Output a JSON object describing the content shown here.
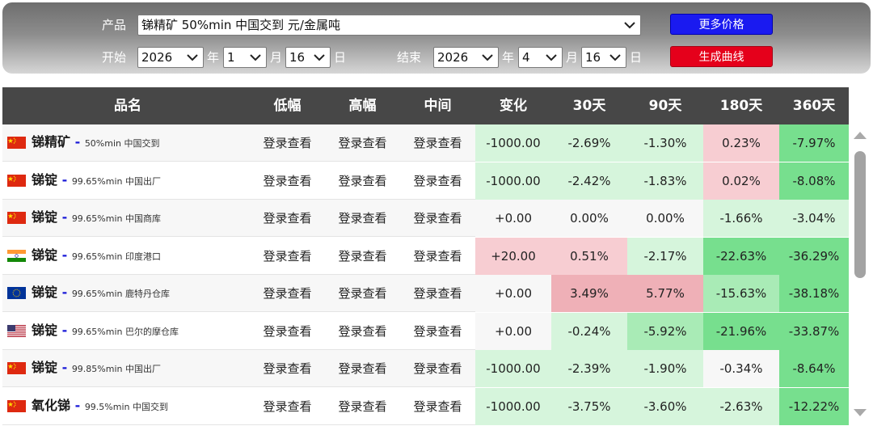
{
  "filters": {
    "product_label": "产品",
    "product_value": "锑精矿 50%min 中国交到 元/金属吨",
    "start_label": "开始",
    "end_label": "结束",
    "start": {
      "year": "2026",
      "year_unit": "年",
      "month": "1",
      "month_unit": "月",
      "day": "16",
      "day_unit": "日"
    },
    "end": {
      "year": "2026",
      "year_unit": "年",
      "month": "4",
      "month_unit": "月",
      "day": "16",
      "day_unit": "日"
    },
    "more_prices_button": "更多价格",
    "generate_curve_button": "生成曲线"
  },
  "colors": {
    "blue_button": "#1a1af0",
    "red_button": "#e5001b",
    "header_bg": "#474747",
    "neutral_cell": "#f7f7f7",
    "green_light": "#d6f5dc",
    "green_mid": "#a9ebb6",
    "green_strong": "#77df8e",
    "red_light": "#f7cdd2",
    "red_mid": "#efb0b7"
  },
  "table": {
    "headers": [
      "品名",
      "低幅",
      "高幅",
      "中间",
      "变化",
      "30天",
      "90天",
      "180天",
      "360天"
    ],
    "rows": [
      {
        "flag": "china-flag",
        "name": "锑精矿",
        "dash": "-",
        "spec": "50%min 中国交到",
        "low": "登录查看",
        "high": "登录查看",
        "mid": "登录查看",
        "change": "-1000.00",
        "d30": "-2.69%",
        "d90": "-1.30%",
        "d180": "0.23%",
        "d360": "-7.97%",
        "tones": [
          "green_light",
          "green_light",
          "green_light",
          "red_light",
          "green_strong"
        ]
      },
      {
        "flag": "china-flag",
        "name": "锑锭",
        "dash": "-",
        "spec": "99.65%min 中国出厂",
        "low": "登录查看",
        "high": "登录查看",
        "mid": "登录查看",
        "change": "-1000.00",
        "d30": "-2.42%",
        "d90": "-1.83%",
        "d180": "0.02%",
        "d360": "-8.08%",
        "tones": [
          "green_light",
          "green_light",
          "green_light",
          "red_light",
          "green_strong"
        ]
      },
      {
        "flag": "china-flag",
        "name": "锑锭",
        "dash": "-",
        "spec": "99.65%min 中国商库",
        "low": "登录查看",
        "high": "登录查看",
        "mid": "登录查看",
        "change": "+0.00",
        "d30": "0.00%",
        "d90": "0.00%",
        "d180": "-1.66%",
        "d360": "-3.04%",
        "tones": [
          "neutral_cell",
          "neutral_cell",
          "neutral_cell",
          "green_light",
          "green_light"
        ]
      },
      {
        "flag": "india-flag",
        "name": "锑锭",
        "dash": "-",
        "spec": "99.65%min 印度港口",
        "low": "登录查看",
        "high": "登录查看",
        "mid": "登录查看",
        "change": "+20.00",
        "d30": "0.51%",
        "d90": "-2.17%",
        "d180": "-22.63%",
        "d360": "-36.29%",
        "tones": [
          "red_light",
          "red_light",
          "green_light",
          "green_strong",
          "green_strong"
        ]
      },
      {
        "flag": "eu-flag",
        "name": "锑锭",
        "dash": "-",
        "spec": "99.65%min 鹿特丹仓库",
        "low": "登录查看",
        "high": "登录查看",
        "mid": "登录查看",
        "change": "+0.00",
        "d30": "3.49%",
        "d90": "5.77%",
        "d180": "-15.63%",
        "d360": "-38.18%",
        "tones": [
          "neutral_cell",
          "red_mid",
          "red_mid",
          "green_mid",
          "green_strong"
        ]
      },
      {
        "flag": "usa-flag",
        "name": "锑锭",
        "dash": "-",
        "spec": "99.65%min 巴尔的摩仓库",
        "low": "登录查看",
        "high": "登录查看",
        "mid": "登录查看",
        "change": "+0.00",
        "d30": "-0.24%",
        "d90": "-5.92%",
        "d180": "-21.96%",
        "d360": "-33.87%",
        "tones": [
          "neutral_cell",
          "green_light",
          "green_mid",
          "green_strong",
          "green_strong"
        ]
      },
      {
        "flag": "china-flag",
        "name": "锑锭",
        "dash": "-",
        "spec": "99.85%min 中国出厂",
        "low": "登录查看",
        "high": "登录查看",
        "mid": "登录查看",
        "change": "-1000.00",
        "d30": "-2.39%",
        "d90": "-1.90%",
        "d180": "-0.34%",
        "d360": "-8.64%",
        "tones": [
          "green_light",
          "green_light",
          "green_light",
          "neutral_cell",
          "green_strong"
        ]
      },
      {
        "flag": "china-flag",
        "name": "氧化锑",
        "dash": "-",
        "spec": "99.5%min 中国交到",
        "low": "登录查看",
        "high": "登录查看",
        "mid": "登录查看",
        "change": "-1000.00",
        "d30": "-3.75%",
        "d90": "-3.60%",
        "d180": "-2.63%",
        "d360": "-12.22%",
        "tones": [
          "green_light",
          "green_light",
          "green_light",
          "green_light",
          "green_strong"
        ]
      }
    ]
  }
}
